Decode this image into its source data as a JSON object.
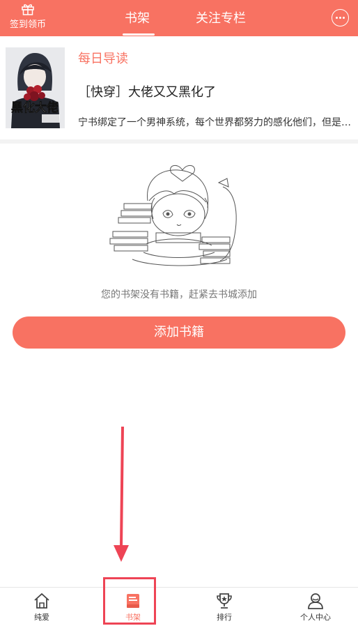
{
  "header": {
    "checkin_label": "签到领币",
    "tabs": [
      {
        "label": "书架",
        "active": true
      },
      {
        "label": "关注专栏",
        "active": false
      }
    ],
    "more_icon": "more-dots-icon"
  },
  "daily_guide": {
    "tag": "每日导读",
    "book_title": "［快穿］大佬又又黑化了",
    "description": "宁书绑定了一个男神系统，每个世界都努力的感化他们，但是每一次都失败，男神又双黑化了",
    "cover_text": "黑化大佬"
  },
  "empty_state": {
    "message": "您的书架没有书籍，赶紧去书城添加",
    "add_button_label": "添加书籍"
  },
  "bottom_nav": [
    {
      "label": "纯爱",
      "icon": "home-icon",
      "active": false
    },
    {
      "label": "书架",
      "icon": "bookshelf-icon",
      "active": true
    },
    {
      "label": "排行",
      "icon": "trophy-icon",
      "active": false
    },
    {
      "label": "个人中心",
      "icon": "user-icon",
      "active": false
    }
  ],
  "colors": {
    "accent": "#f87262",
    "annotation_red": "#ee4455"
  }
}
